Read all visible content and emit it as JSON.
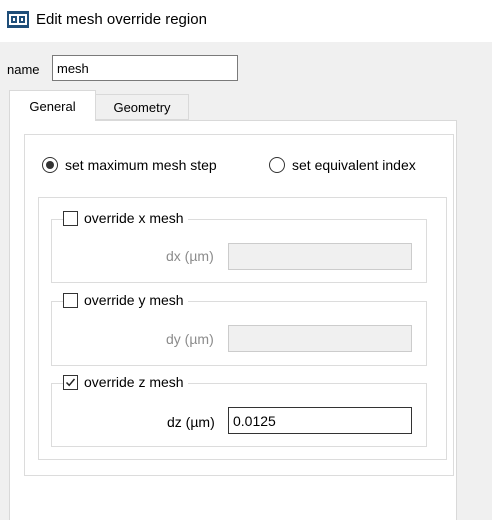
{
  "window": {
    "title": "Edit mesh override region",
    "icon": "app-window-icon"
  },
  "name_field": {
    "label": "name",
    "value": "mesh"
  },
  "tabs": [
    {
      "label": "General",
      "active": true
    },
    {
      "label": "Geometry",
      "active": false
    }
  ],
  "mode": {
    "options": [
      {
        "label": "set maximum mesh step",
        "selected": true
      },
      {
        "label": "set equivalent index",
        "selected": false
      }
    ]
  },
  "overrides": {
    "x": {
      "checkbox_label": "override x mesh",
      "checked": false,
      "field_label": "dx (µm)",
      "value": ""
    },
    "y": {
      "checkbox_label": "override y mesh",
      "checked": false,
      "field_label": "dy (µm)",
      "value": ""
    },
    "z": {
      "checkbox_label": "override z mesh",
      "checked": true,
      "field_label": "dz (µm)",
      "value": "0.0125"
    }
  },
  "colors": {
    "accent": "#1f4e79",
    "disabled_text": "#8c8c8c",
    "dialog_bg": "#f0f0f0"
  }
}
